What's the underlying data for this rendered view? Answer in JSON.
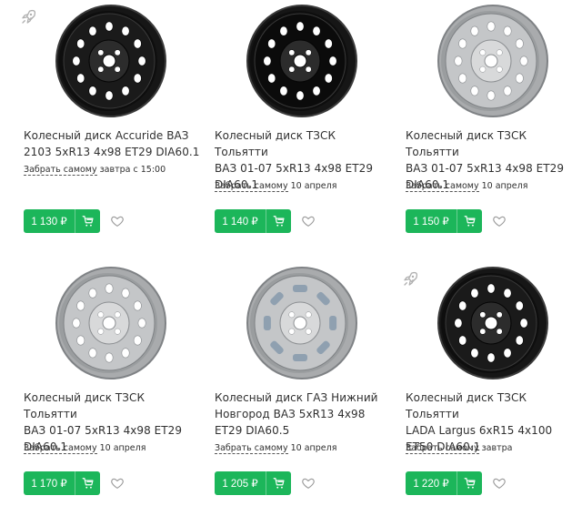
{
  "products": [
    {
      "title_lines": [
        "Колесный диск Accuride ВАЗ",
        "2103 5xR13 4x98 ET29 DIA60.1",
        ""
      ],
      "pickup_label": "Забрать самому",
      "pickup_date": " завтра с 15:00",
      "price": "1 130 ₽",
      "wheel_style": "black",
      "express": true
    },
    {
      "title_lines": [
        "Колесный диск ТЗСК Тольятти",
        "ВАЗ 01-07 5xR13 4x98 ET29",
        "DIA60.1"
      ],
      "pickup_label": "Забрать самому",
      "pickup_date": " 10 апреля",
      "price": "1 140 ₽",
      "wheel_style": "black-glossy",
      "express": false
    },
    {
      "title_lines": [
        "Колесный диск ТЗСК Тольятти",
        "ВАЗ 01-07 5xR13 4x98 ET29",
        "DIA60.1"
      ],
      "pickup_label": "Забрать самому",
      "pickup_date": " 10 апреля",
      "price": "1 150 ₽",
      "wheel_style": "silver",
      "express": false
    },
    {
      "title_lines": [
        "Колесный диск ТЗСК Тольятти",
        "ВАЗ 01-07 5xR13 4x98 ET29",
        "DIA60.1"
      ],
      "pickup_label": "Забрать самому",
      "pickup_date": " 10 апреля",
      "price": "1 170 ₽",
      "wheel_style": "silver",
      "express": false
    },
    {
      "title_lines": [
        "Колесный диск ГАЗ Нижний",
        "Новгород ВАЗ 5xR13 4x98",
        "ET29 DIA60.5"
      ],
      "pickup_label": "Забрать самому",
      "pickup_date": " 10 апреля",
      "price": "1 205 ₽",
      "wheel_style": "silver-slots",
      "express": false
    },
    {
      "title_lines": [
        "Колесный диск ТЗСК Тольятти",
        "LADA Largus 6xR15 4x100",
        "ET50 DIA60.1"
      ],
      "pickup_label": "Забрать самому",
      "pickup_date": " завтра",
      "price": "1 220 ₽",
      "wheel_style": "black",
      "express": true
    }
  ],
  "icons": {
    "cart": "cart-icon",
    "favorite": "heart-icon",
    "express": "rocket-icon"
  },
  "colors": {
    "buy_button": "#1cb65a",
    "favorite_icon": "#9a9a9a",
    "express_icon": "#b0b0b0"
  }
}
